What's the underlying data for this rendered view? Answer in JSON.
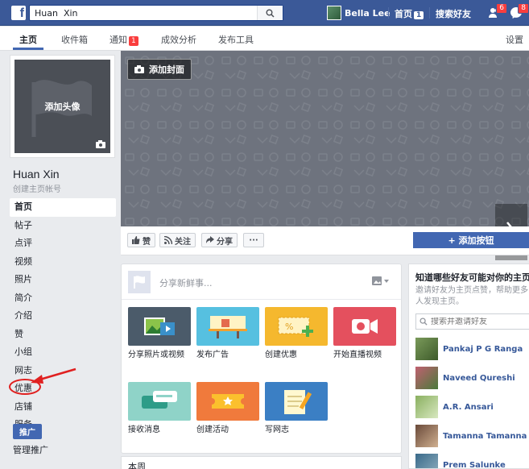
{
  "topbar": {
    "search_value": "Huan  Xin",
    "user_name": "Bella Lee",
    "home_label": "首页",
    "home_count": "1",
    "find_friends_label": "搜索好友",
    "friend_requests_badge": "6",
    "messages_badge": "8"
  },
  "subnav": {
    "tabs": [
      {
        "label": "主页"
      },
      {
        "label": "收件箱"
      },
      {
        "label": "通知",
        "badge": "1"
      },
      {
        "label": "成效分析"
      },
      {
        "label": "发布工具"
      }
    ],
    "settings_label": "设置"
  },
  "profile": {
    "add_avatar_label": "添加头像",
    "name": "Huan Xin",
    "create_account_label": "创建主页帐号"
  },
  "left_menu": {
    "items": [
      {
        "label": "首页"
      },
      {
        "label": "帖子"
      },
      {
        "label": "点评"
      },
      {
        "label": "视频"
      },
      {
        "label": "照片"
      },
      {
        "label": "简介"
      },
      {
        "label": "介绍"
      },
      {
        "label": "赞"
      },
      {
        "label": "小组"
      },
      {
        "label": "网志"
      },
      {
        "label": "优惠"
      },
      {
        "label": "店铺"
      },
      {
        "label": "服务"
      }
    ],
    "promote_label": "推广",
    "manage_promotions_label": "管理推广"
  },
  "cover": {
    "add_cover_label": "添加封面"
  },
  "actions": {
    "like_label": "赞",
    "follow_label": "关注",
    "share_label": "分享",
    "more_label": "···",
    "add_button_label": "+ 添加按钮"
  },
  "composer": {
    "placeholder": "分享新鲜事...",
    "tiles": [
      {
        "label": "分享照片或视频"
      },
      {
        "label": "发布广告"
      },
      {
        "label": "创建优惠"
      },
      {
        "label": "开始直播视频"
      },
      {
        "label": "接收消息"
      },
      {
        "label": "创建活动"
      },
      {
        "label": "写网志"
      }
    ]
  },
  "suggestions": {
    "title": "知道哪些好友可能对你的主页感兴趣",
    "description": "邀请好友为主页点赞，帮助更多人发现主页。",
    "search_placeholder": "搜索并邀请好友",
    "friends": [
      {
        "name": "Pankaj P G Ranga"
      },
      {
        "name": "Naveed Qureshi"
      },
      {
        "name": "A.R. Ansari"
      },
      {
        "name": "Tamanna Tamanna"
      },
      {
        "name": "Prem Salunke"
      }
    ]
  },
  "this_week": {
    "label": "本周"
  }
}
